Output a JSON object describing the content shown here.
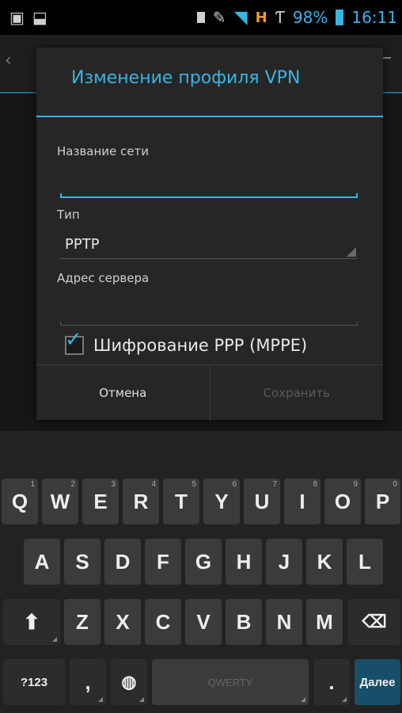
{
  "status_bar": {
    "battery": "98%",
    "time": "16:11",
    "network": "H",
    "icons": [
      "image-icon",
      "download-icon",
      "sim-card-icon",
      "nfc-icon",
      "wifi-icon",
      "mobile-data-icon",
      "roaming-signal-icon",
      "battery-icon"
    ]
  },
  "dialog": {
    "title": "Изменение профиля VPN",
    "name_label": "Название сети",
    "name_value": "",
    "type_label": "Тип",
    "type_value": "PPTP",
    "server_label": "Адрес сервера",
    "server_value": "",
    "encryption_label": "Шифрование PPP (MPPE)",
    "encryption_checked": true,
    "cancel_label": "Отмена",
    "save_label": "Сохранить"
  },
  "keyboard": {
    "row1": [
      {
        "label": "Q",
        "hint": "1"
      },
      {
        "label": "W",
        "hint": "2"
      },
      {
        "label": "E",
        "hint": "3"
      },
      {
        "label": "R",
        "hint": "4"
      },
      {
        "label": "T",
        "hint": "5"
      },
      {
        "label": "Y",
        "hint": "6"
      },
      {
        "label": "U",
        "hint": "7"
      },
      {
        "label": "I",
        "hint": "8"
      },
      {
        "label": "O",
        "hint": "9"
      },
      {
        "label": "P",
        "hint": "0"
      }
    ],
    "row2": [
      "A",
      "S",
      "D",
      "F",
      "G",
      "H",
      "J",
      "K",
      "L"
    ],
    "row3": [
      "Z",
      "X",
      "C",
      "V",
      "B",
      "N",
      "M"
    ],
    "symbols_label": "?123",
    "comma_label": ",",
    "space_label": "QWERTY",
    "period_label": ".",
    "next_label": "Далее"
  },
  "colors": {
    "accent": "#35b6e5",
    "network": "#f29b20"
  }
}
